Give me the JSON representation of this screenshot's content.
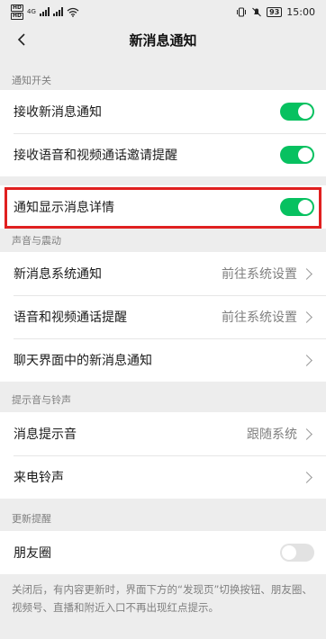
{
  "status": {
    "sim1": "HD",
    "sim2": "HD",
    "network": "4G",
    "battery": "93",
    "time": "15:00"
  },
  "nav": {
    "title": "新消息通知"
  },
  "sections": {
    "notify_switch": {
      "header": "通知开关",
      "rows": [
        {
          "label": "接收新消息通知",
          "toggle": "on"
        },
        {
          "label": "接收语音和视频通话邀请提醒",
          "toggle": "on"
        }
      ]
    },
    "details": {
      "label": "通知显示消息详情",
      "toggle": "on"
    },
    "sound": {
      "header": "声音与震动",
      "rows": [
        {
          "label": "新消息系统通知",
          "value": "前往系统设置"
        },
        {
          "label": "语音和视频通话提醒",
          "value": "前往系统设置"
        },
        {
          "label": "聊天界面中的新消息通知"
        }
      ]
    },
    "ringtone": {
      "header": "提示音与铃声",
      "rows": [
        {
          "label": "消息提示音",
          "value": "跟随系统"
        },
        {
          "label": "来电铃声"
        }
      ]
    },
    "updates": {
      "header": "更新提醒",
      "rows": [
        {
          "label": "朋友圈",
          "toggle": "off"
        }
      ],
      "footnote": "关闭后，有内容更新时，界面下方的“发现页”切换按钮、朋友圈、视频号、直播和附近入口不再出现红点提示。"
    }
  },
  "colors": {
    "toggle_on": "#07c160",
    "highlight": "#e02020",
    "background": "#ededed"
  }
}
